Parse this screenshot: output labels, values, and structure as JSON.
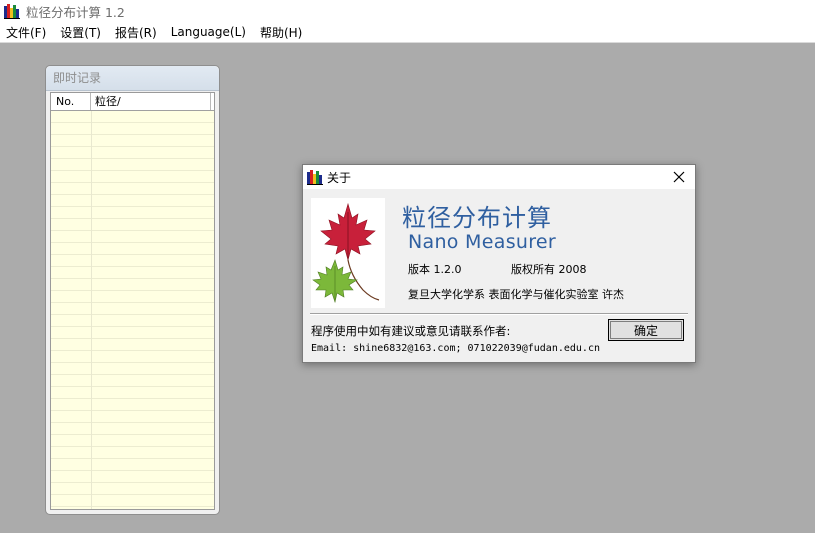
{
  "app": {
    "title": "粒径分布计算 1.2",
    "icon": "app-icon"
  },
  "menu": [
    "文件(F)",
    "设置(T)",
    "报告(R)",
    "Language(L)",
    "帮助(H)"
  ],
  "child_window": {
    "title": "即时记录",
    "columns": [
      "No.",
      "粒径/"
    ]
  },
  "dialog": {
    "title": "关于",
    "product_name_cn": "粒径分布计算",
    "product_name_en": "Nano Measurer",
    "version": "版本 1.2.0",
    "copyright": "版权所有 2008",
    "organization": "复旦大学化学系 表面化学与催化实验室 许杰",
    "contact_prompt": "程序使用中如有建议或意见请联系作者:",
    "email": "Email: shine6832@163.com; 071022039@fudan.edu.cn",
    "ok_label": "确定",
    "logo": "maple-leaf-logo"
  },
  "colors": {
    "mdi_background": "#ababab",
    "list_background": "#ffffe2",
    "product_text": "#2f5fa0"
  }
}
